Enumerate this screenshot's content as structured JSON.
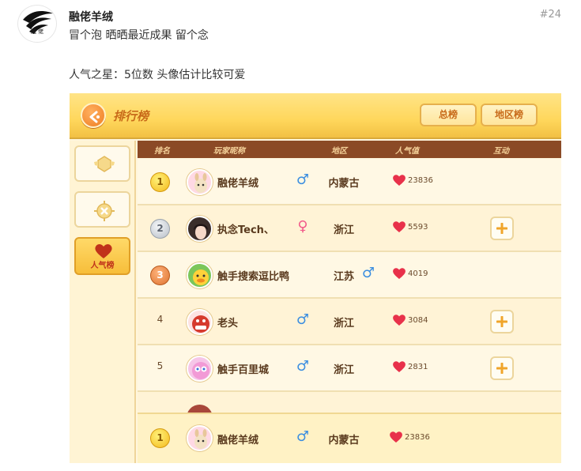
{
  "post": {
    "username": "融佬羊绒",
    "floor": "#24",
    "line1": "冒个泡 晒晒最近成果 留个念",
    "line2": "人气之星：5位数 头像估计比较可爱",
    "avatar_logo_text": "融 佬"
  },
  "game": {
    "title": "排行榜",
    "tabs": {
      "total": "总榜",
      "region": "地区榜"
    },
    "sidebar": {
      "popularity_label": "人气榜"
    },
    "columns": {
      "rank": "排名",
      "nickname": "玩家昵称",
      "region": "地区",
      "popularity": "人气值",
      "interact": "互动"
    },
    "rows": [
      {
        "rank": "1",
        "name": "融佬羊绒",
        "gender": "♂",
        "region": "内蒙古",
        "popularity": "23836",
        "has_plus": false
      },
      {
        "rank": "2",
        "name": "执念Tech、",
        "gender": "♀",
        "region": "浙江",
        "popularity": "5593",
        "has_plus": true
      },
      {
        "rank": "3",
        "name": "触手搜索逗比鸭",
        "gender": "♂",
        "region": "江苏",
        "popularity": "4019",
        "has_plus": false
      },
      {
        "rank": "4",
        "name": "老头",
        "gender": "♂",
        "region": "浙江",
        "popularity": "3084",
        "has_plus": true
      },
      {
        "rank": "5",
        "name": "触手百里城",
        "gender": "♂",
        "region": "浙江",
        "popularity": "2831",
        "has_plus": true
      }
    ],
    "my_row": {
      "rank": "1",
      "name": "融佬羊绒",
      "gender": "♂",
      "region": "内蒙古",
      "popularity": "23836"
    },
    "colors": {
      "topbar": "#ffd75c",
      "header_brown": "#8b4a26",
      "accent_orange": "#ef7d22",
      "male_blue": "#3b8ee0",
      "female_pink": "#f25a8a",
      "heart_red": "#e8314a"
    }
  }
}
